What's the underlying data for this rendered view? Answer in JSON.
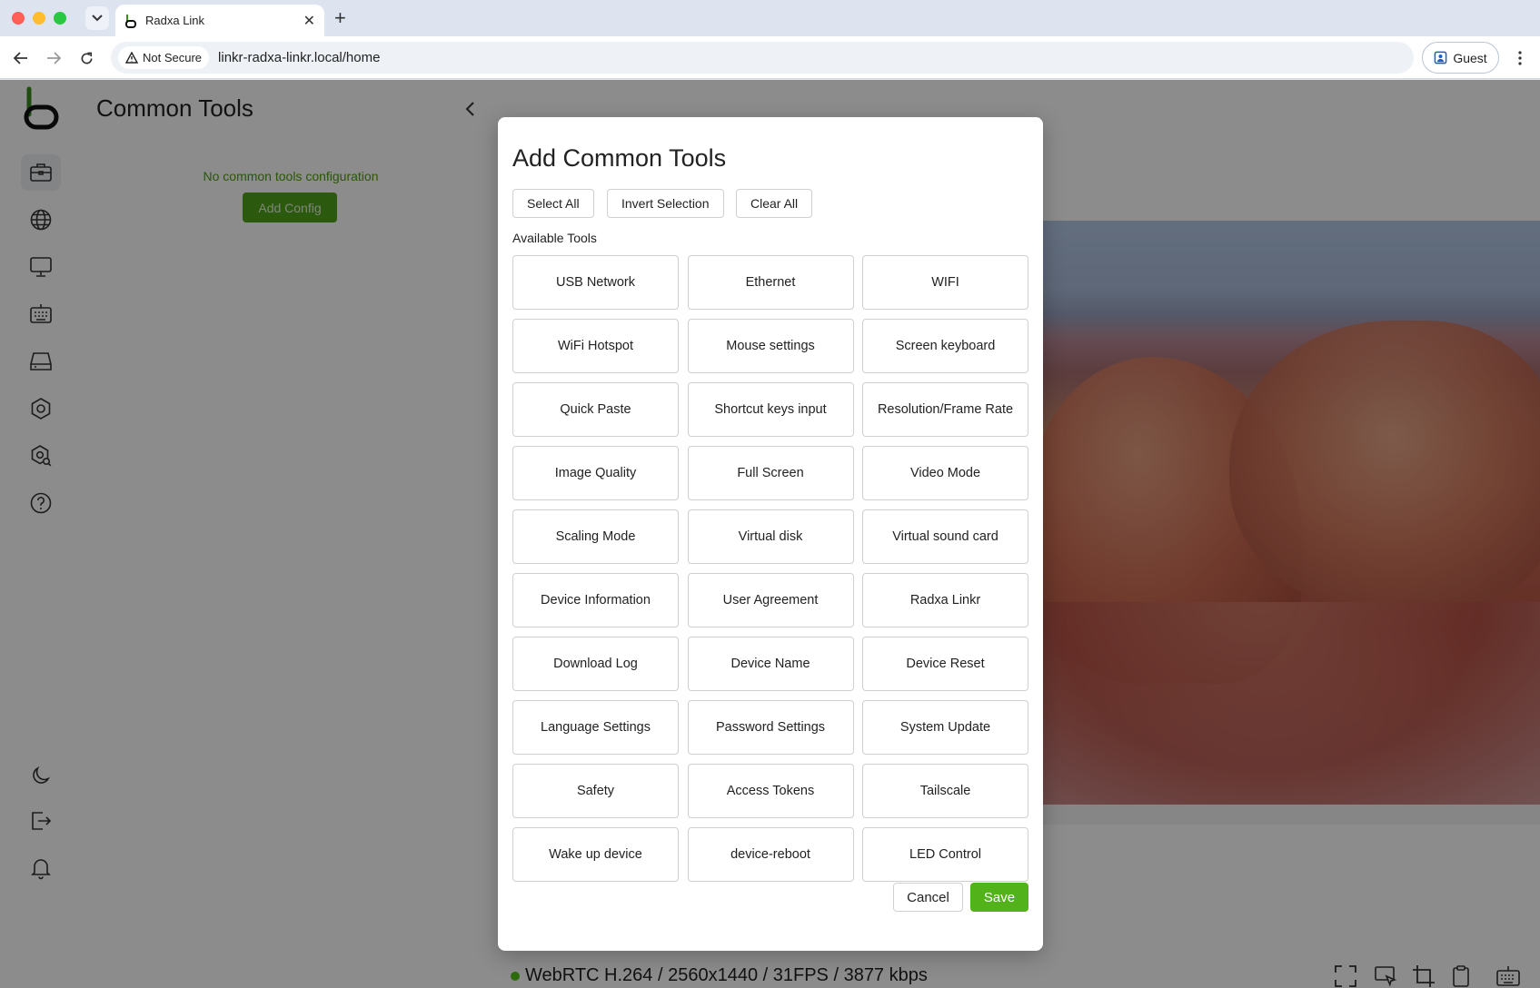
{
  "browser": {
    "tab_title": "Radxa Link",
    "security_label": "Not Secure",
    "url": "linkr-radxa-linkr.local/home",
    "profile_label": "Guest"
  },
  "panel": {
    "title": "Common Tools",
    "empty_message": "No common tools configuration",
    "add_config_label": "Add Config"
  },
  "modal": {
    "title": "Add Common Tools",
    "select_all": "Select All",
    "invert_selection": "Invert Selection",
    "clear_all": "Clear All",
    "available_label": "Available Tools",
    "tools": [
      "USB Network",
      "Ethernet",
      "WIFI",
      "WiFi Hotspot",
      "Mouse settings",
      "Screen keyboard",
      "Quick Paste",
      "Shortcut keys input",
      "Resolution/Frame Rate",
      "Image Quality",
      "Full Screen",
      "Video Mode",
      "Scaling Mode",
      "Virtual disk",
      "Virtual sound card",
      "Device Information",
      "User Agreement",
      "Radxa Linkr",
      "Download Log",
      "Device Name",
      "Device Reset",
      "Language Settings",
      "Password Settings",
      "System Update",
      "Safety",
      "Access Tokens",
      "Tailscale",
      "Wake up device",
      "device-reboot",
      "LED Control"
    ],
    "cancel_label": "Cancel",
    "save_label": "Save"
  },
  "viewer": {
    "status_text": "WebRTC H.264 / 2560x1440 / 31FPS / 3877 kbps"
  },
  "colors": {
    "accent": "#52b21a",
    "status_dot": "#52c41a"
  }
}
